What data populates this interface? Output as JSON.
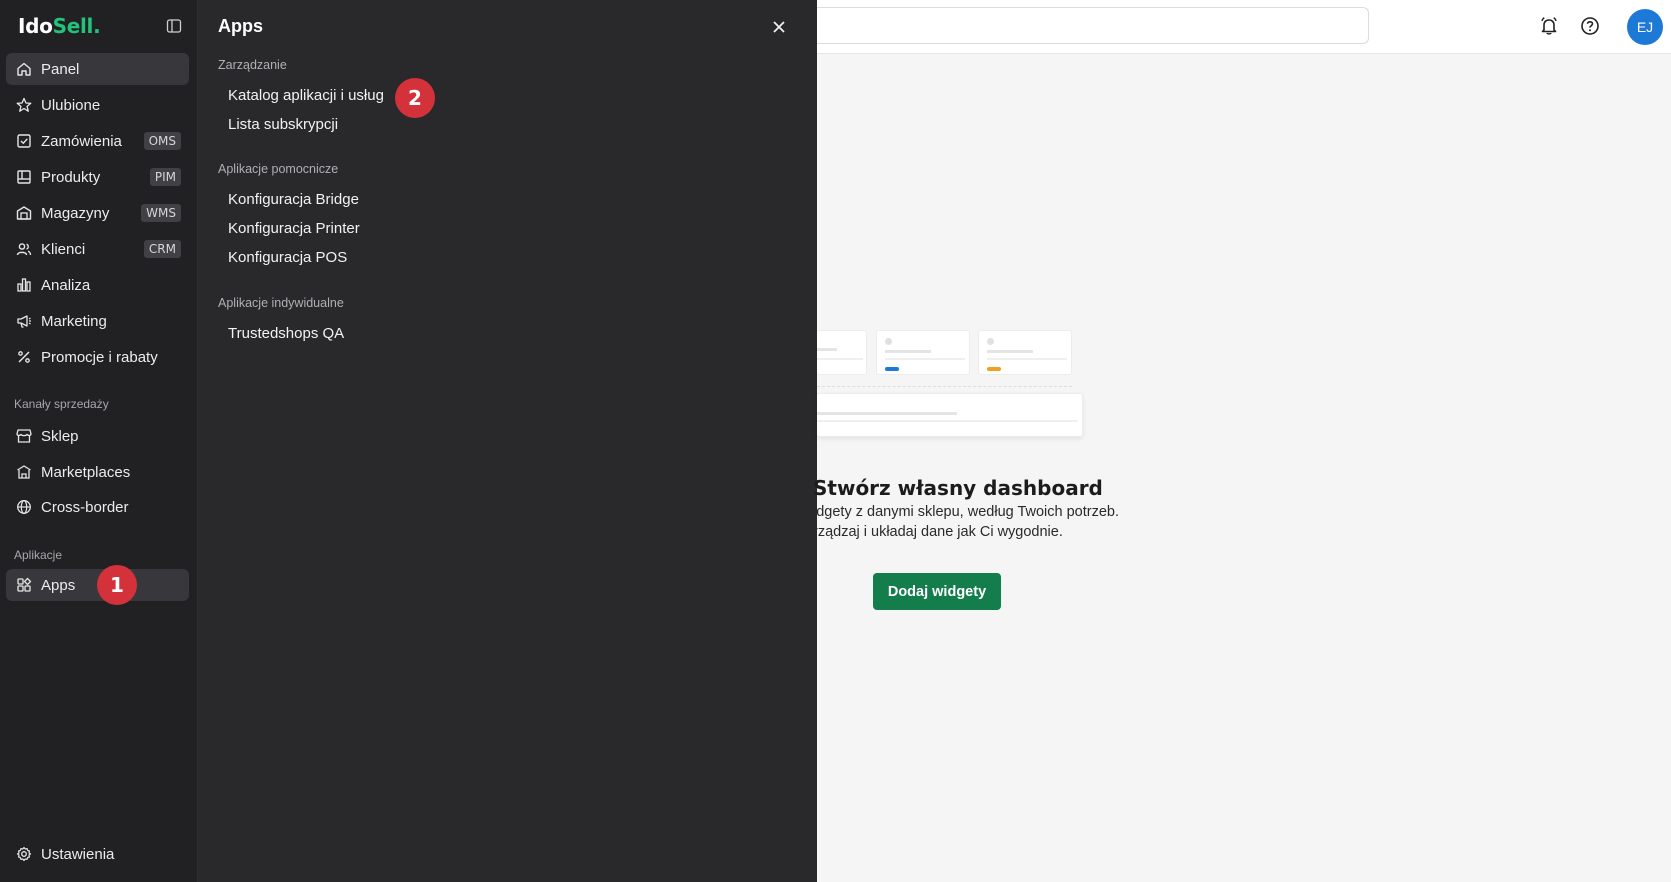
{
  "brand": {
    "logo_part1": "Ido",
    "logo_part2": "Sell",
    "logo_part3": "."
  },
  "sidebar": {
    "items": [
      {
        "label": "Panel",
        "icon": "home-icon"
      },
      {
        "label": "Ulubione",
        "icon": "star-icon"
      },
      {
        "label": "Zamówienia",
        "icon": "order-icon",
        "badge": "OMS"
      },
      {
        "label": "Produkty",
        "icon": "product-icon",
        "badge": "PIM"
      },
      {
        "label": "Magazyny",
        "icon": "warehouse-icon",
        "badge": "WMS"
      },
      {
        "label": "Klienci",
        "icon": "users-icon",
        "badge": "CRM"
      },
      {
        "label": "Analiza",
        "icon": "chart-icon"
      },
      {
        "label": "Marketing",
        "icon": "megaphone-icon"
      },
      {
        "label": "Promocje i rabaty",
        "icon": "percent-icon"
      }
    ],
    "sales_title": "Kanały sprzedaży",
    "sales_items": [
      {
        "label": "Sklep",
        "icon": "store-icon"
      },
      {
        "label": "Marketplaces",
        "icon": "marketplace-icon"
      },
      {
        "label": "Cross-border",
        "icon": "globe-icon"
      }
    ],
    "apps_title": "Aplikacje",
    "apps_item": {
      "label": "Apps",
      "icon": "apps-grid-icon"
    },
    "settings": {
      "label": "Ustawienia",
      "icon": "gear-icon"
    }
  },
  "markers": {
    "one": "1",
    "two": "2"
  },
  "apps_panel": {
    "title": "Apps",
    "groups": [
      {
        "title": "Zarządzanie",
        "links": [
          "Katalog aplikacji i usług",
          "Lista subskrypcji"
        ]
      },
      {
        "title": "Aplikacje pomocnicze",
        "links": [
          "Konfiguracja Bridge",
          "Konfiguracja Printer",
          "Konfiguracja POS"
        ]
      },
      {
        "title": "Aplikacje indywidualne",
        "links": [
          "Trustedshops QA"
        ]
      }
    ]
  },
  "topbar": {
    "avatar_initials": "EJ"
  },
  "main": {
    "title": "Stwórz własny dashboard",
    "desc_line1": "idgety z danymi sklepu, według Twoich potrzeb.",
    "desc_line2": "rządzaj i układaj dane jak Ci wygodnie.",
    "button": "Dodaj widgety"
  },
  "colors": {
    "accent_green": "#137e4c",
    "marker_red": "#d4323a",
    "avatar_blue": "#1d79d6",
    "sidebar_bg": "#212124"
  }
}
